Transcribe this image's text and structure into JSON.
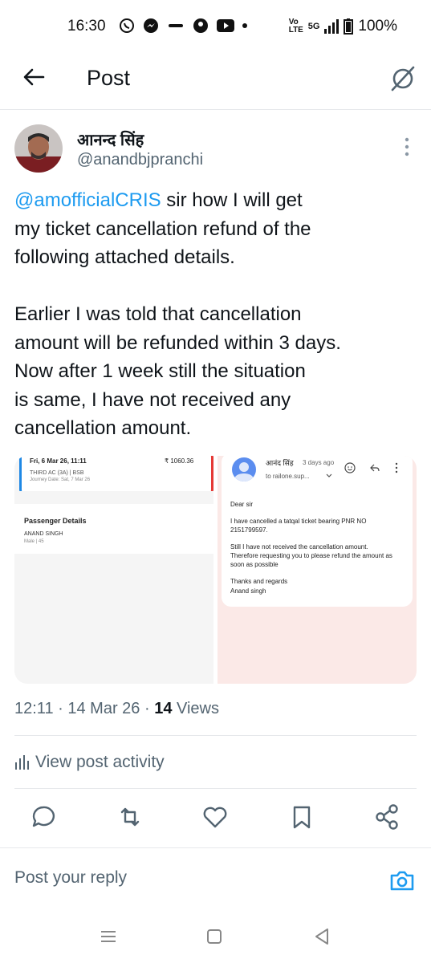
{
  "status_bar": {
    "time": "16:30",
    "battery": "100%",
    "network": "5G",
    "volte": "Vo LTE",
    "notification_icons": [
      "whatsapp-icon",
      "messenger-icon",
      "app-icon",
      "app-icon-2",
      "youtube-icon"
    ]
  },
  "header": {
    "title": "Post",
    "back_icon": "arrow-left-icon",
    "grok_icon": "grok-icon"
  },
  "author": {
    "name": "आनन्द सिंह",
    "handle": "@anandbjpranchi"
  },
  "post": {
    "mention": "@amofficialCRIS",
    "text_1": " sir how I will get\nmy ticket cancellation refund of the\nfollowing attached details.\n\nEarlier I was told that cancellation\namount will be refunded within 3 days.\nNow after 1 week still the situation\nis same, I have not received any\ncancellation amount."
  },
  "media": {
    "left": {
      "date": "Fri, 6 Mar 26, 11:11",
      "amount": "₹ 1060.36",
      "class": "THIRD AC (3A) | BSB",
      "journey": "Journey Date: Sat, 7 Mar 26",
      "section": "Passenger Details",
      "passenger": "ANAND SINGH",
      "passenger_info": "Male | 45"
    },
    "right": {
      "sender": "आनंद सिंह",
      "when": "3 days ago",
      "to": "to railone.sup...",
      "greeting": "Dear sir",
      "para1": "I have cancelled a tatqal ticket bearing PNR NO 2151799597.",
      "para2": "Still I have not received the cancellation amount. Therefore requesting you to please refund the amount as soon as possible",
      "closing": "Thanks and regards",
      "signature": "Anand singh"
    }
  },
  "meta": {
    "time": "12:11",
    "sep": " · ",
    "date": "14 Mar 26",
    "views_count": "14",
    "views_label": " Views"
  },
  "activity": {
    "label": "View post activity"
  },
  "actions": [
    "reply-icon",
    "repost-icon",
    "like-icon",
    "bookmark-icon",
    "share-icon"
  ],
  "reply": {
    "placeholder": "Post your reply"
  },
  "colors": {
    "accent": "#1d9bf0",
    "text": "#0f1419",
    "muted": "#536471"
  }
}
